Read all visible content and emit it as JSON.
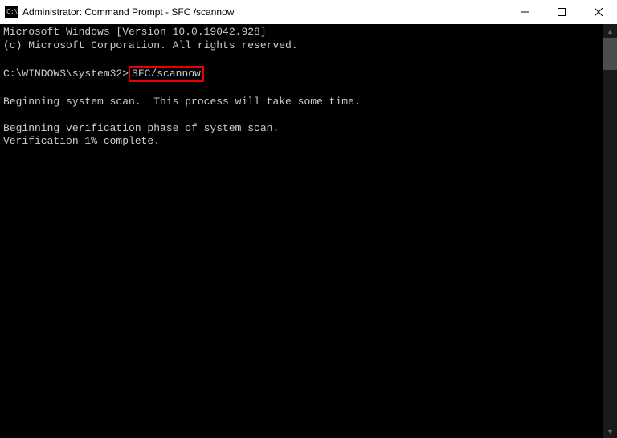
{
  "titlebar": {
    "icon_label": "cmd-icon",
    "title": "Administrator: Command Prompt - SFC  /scannow"
  },
  "terminal": {
    "line1": "Microsoft Windows [Version 10.0.19042.928]",
    "line2": "(c) Microsoft Corporation. All rights reserved.",
    "prompt_prefix": "C:\\WINDOWS\\system32>",
    "command": "SFC/scannow",
    "line4": "Beginning system scan.  This process will take some time.",
    "line5": "Beginning verification phase of system scan.",
    "line6": "Verification 1% complete."
  }
}
